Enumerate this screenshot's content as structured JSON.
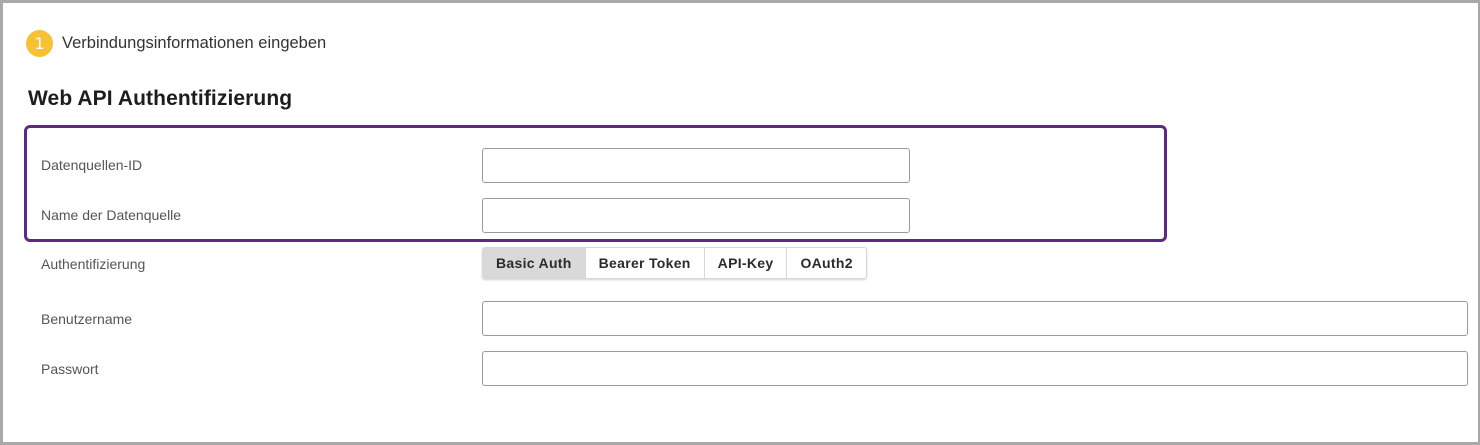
{
  "step": {
    "number": "1",
    "label": "Verbindungsinformationen eingeben"
  },
  "section": {
    "title": "Web API Authentifizierung"
  },
  "fields": {
    "datasource_id": {
      "label": "Datenquellen-ID",
      "value": ""
    },
    "datasource_name": {
      "label": "Name der Datenquelle",
      "value": ""
    },
    "authentication": {
      "label": "Authentifizierung"
    },
    "username": {
      "label": "Benutzername",
      "value": ""
    },
    "password": {
      "label": "Passwort",
      "value": ""
    }
  },
  "auth_tabs": [
    "Basic Auth",
    "Bearer Token",
    "API-Key",
    "OAuth2"
  ],
  "auth_selected": "Basic Auth",
  "colors": {
    "step_badge": "#f6c133",
    "highlight_border": "#5b2a86",
    "active_tab": "#d9d9d9"
  }
}
